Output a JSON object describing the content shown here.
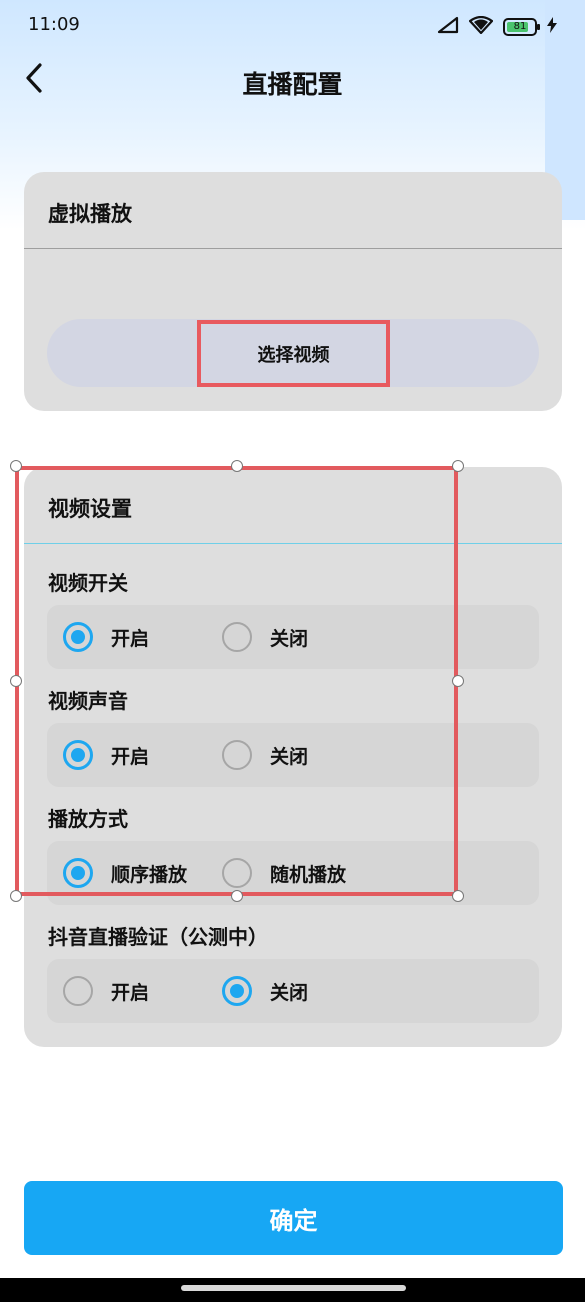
{
  "status_bar": {
    "time": "11:09",
    "battery_level": "81",
    "signal_icon": "cellular-signal-icon",
    "wifi_icon": "wifi-icon",
    "charging_icon": "lightning-icon"
  },
  "header": {
    "title": "直播配置",
    "back_icon": "chevron-left-icon"
  },
  "virtual_play": {
    "title": "虚拟播放",
    "select_video_label": "选择视频"
  },
  "video_settings": {
    "title": "视频设置",
    "groups": [
      {
        "label": "视频开关",
        "options": [
          "开启",
          "关闭"
        ],
        "selected": 0
      },
      {
        "label": "视频声音",
        "options": [
          "开启",
          "关闭"
        ],
        "selected": 0
      },
      {
        "label": "播放方式",
        "options": [
          "顺序播放",
          "随机播放"
        ],
        "selected": 0
      },
      {
        "label": "抖音直播验证（公测中）",
        "options": [
          "开启",
          "关闭"
        ],
        "selected": 1
      }
    ]
  },
  "confirm_label": "确定",
  "colors": {
    "accent": "#1ea7f0",
    "confirm_bg": "#17a7f4",
    "selection_red": "#e25a5e",
    "card_bg": "#dedede"
  }
}
